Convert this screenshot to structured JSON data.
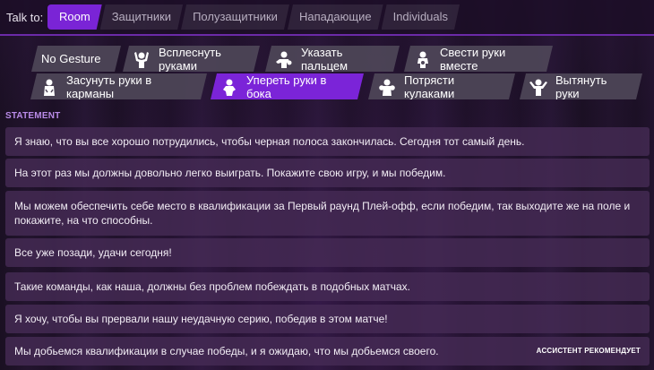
{
  "talk_to": {
    "label": "Talk to:",
    "tabs": [
      "Room",
      "Защитники",
      "Полузащитники",
      "Нападающие",
      "Individuals"
    ],
    "active_tab": "Room"
  },
  "gestures": {
    "items": [
      {
        "label": "No Gesture",
        "icon": "none",
        "active": false
      },
      {
        "label": "Всплеснуть руками",
        "icon": "hands-up-icon",
        "active": false
      },
      {
        "label": "Указать пальцем",
        "icon": "point-finger-icon",
        "active": false
      },
      {
        "label": "Свести руки вместе",
        "icon": "hands-together-icon",
        "active": false
      },
      {
        "label": "Засунуть руки в карманы",
        "icon": "hands-in-pockets-icon",
        "active": false
      },
      {
        "label": "Упереть руки в бока",
        "icon": "hands-on-hips-icon",
        "active": true
      },
      {
        "label": "Потрясти кулаками",
        "icon": "shake-fists-icon",
        "active": false
      },
      {
        "label": "Вытянуть руки",
        "icon": "outstretched-arms-icon",
        "active": false
      }
    ]
  },
  "statement": {
    "title": "STATEMENT",
    "items": [
      {
        "text": "Я знаю, что вы все хорошо потрудились, чтобы черная полоса закончилась. Сегодня тот самый день.",
        "badge": ""
      },
      {
        "text": "На этот раз мы должны довольно легко выиграть. Покажите свою игру, и мы победим.",
        "badge": ""
      },
      {
        "text": "Мы можем обеспечить себе место в квалификации за Первый раунд Плей-офф, если победим, так выходите же на поле и покажите, на что способны.",
        "badge": ""
      },
      {
        "text": "Все уже позади, удачи сегодня!",
        "badge": ""
      },
      {
        "text": "Такие команды, как наша, должны без проблем побеждать в подобных матчах.",
        "badge": ""
      },
      {
        "text": "Я хочу, чтобы вы прервали нашу неудачную серию, победив в этом матче!",
        "badge": ""
      },
      {
        "text": "Мы добьемся квалификации в случае победы, и я ожидаю, что мы добьемся своего.",
        "badge": "АССИСТЕНТ РЕКОМЕНДУЕТ"
      }
    ]
  },
  "colors": {
    "accent": "#7a24d6",
    "statement_title": "#b98be8"
  }
}
